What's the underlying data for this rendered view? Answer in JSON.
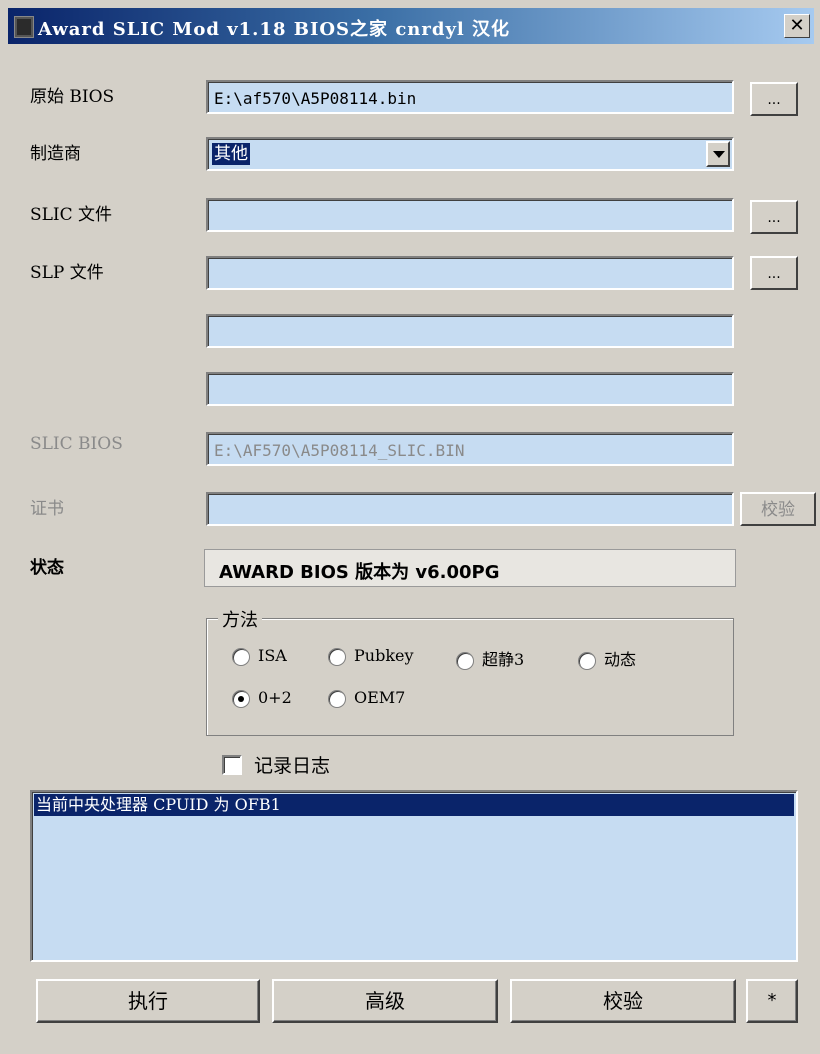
{
  "window": {
    "title": "Award SLIC Mod v1.18  BIOS之家 cnrdyl 汉化",
    "close_label": "✕"
  },
  "form": {
    "bios_label": "原始 BIOS",
    "bios_value": "E:\\af570\\A5P08114.bin",
    "browse_label": "...",
    "maker_label": "制造商",
    "maker_value": "其他",
    "slic_label": "SLIC 文件",
    "slic_value": "",
    "slp_label": "SLP 文件",
    "slp_value": "",
    "extra1_value": "",
    "extra2_value": "",
    "slic_bios_label": "SLIC BIOS",
    "slic_bios_value": "E:\\AF570\\A5P08114_SLIC.BIN",
    "cert_label": "证书",
    "cert_value": "",
    "verify_small_label": "校验",
    "status_label": "状态",
    "status_value": "AWARD BIOS 版本为 v6.00PG"
  },
  "method": {
    "legend": "方法",
    "options": [
      {
        "label": "ISA",
        "checked": false
      },
      {
        "label": "Pubkey",
        "checked": false
      },
      {
        "label": "超静3",
        "checked": false
      },
      {
        "label": "动态",
        "checked": false
      },
      {
        "label": "0+2",
        "checked": true
      },
      {
        "label": "OEM7",
        "checked": false
      }
    ]
  },
  "log_option": {
    "label": "记录日志",
    "checked": false
  },
  "log": {
    "lines": [
      "当前中央处理器 CPUID 为 OFB1"
    ]
  },
  "buttons": {
    "execute": "执行",
    "advanced": "高级",
    "verify": "校验",
    "star": "*"
  }
}
